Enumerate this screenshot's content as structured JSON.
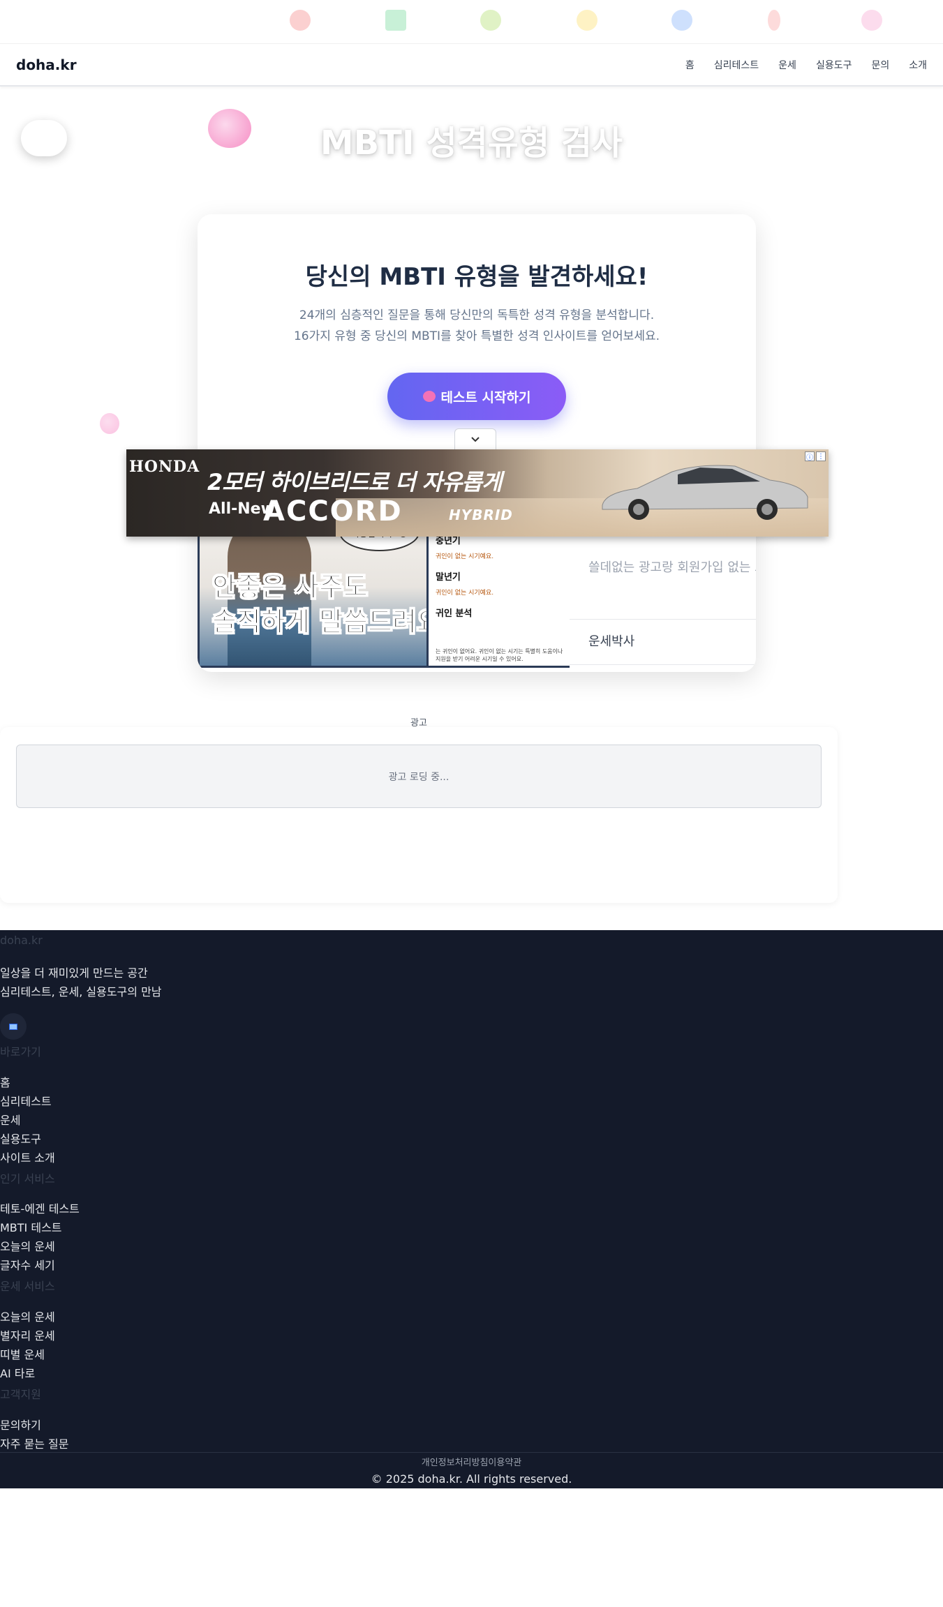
{
  "top_icons": [
    "target-icon",
    "chart-icon",
    "puzzle-icon",
    "bulb-icon",
    "magnifier-icon",
    "bolt-icon",
    "brain-icon"
  ],
  "top_icon_colors": [
    "#ef4444",
    "#22c55e",
    "#84cc16",
    "#facc15",
    "#3b82f6",
    "#f87171",
    "#f472b6"
  ],
  "header": {
    "logo": "doha.kr",
    "nav": [
      "홈",
      "심리테스트",
      "운세",
      "실용도구",
      "문의",
      "소개"
    ]
  },
  "hero": {
    "title": "MBTI 성격유형 검사"
  },
  "card": {
    "title": "당신의 MBTI 유형을 발견하세요!",
    "desc_line1": "24개의 심층적인 질문을 통해 당신만의 독특한 성격 유형을 분석합니다.",
    "desc_line2": "16가지 유형 중 당신의 MBTI를 찾아 특별한 성격 인사이트를 얻어보세요.",
    "start_button": "테스트 시작하기"
  },
  "promo": {
    "bubble": "죄송합니다..😅",
    "headline_line1": "안좋은 사주도",
    "headline_line2": "솔직하게 말씀드려요..",
    "right_label_1": "중년기",
    "right_label_2": "말년기",
    "right_label_3": "귀인 분석",
    "right_sub": "귀인이 없는 시기예요.",
    "right_small": "는 귀인이 없어요. 귀인이 없는 시기는 특별히 도움이나 지원을 받기 어려운 시기일 수 있어요.",
    "text": "쓸데없는 광고랑 회원가입 없는 고",
    "source": "운세박사"
  },
  "ad_banner": {
    "brand": "HONDA",
    "headline": "2모터 하이브리드로 더 자유롭게",
    "all_new": "All-New",
    "model": "ACCORD",
    "model_suffix": "HYBRID",
    "info_icon": "ⓘ",
    "close_icon": "⋮"
  },
  "ad_section": {
    "label": "광고",
    "loading": "광고 로딩 중..."
  },
  "footer": {
    "heading_site": "doha.kr",
    "tagline1": "일상을 더 재미있게 만드는 공간",
    "tagline2": "심리테스트, 운세, 실용도구의 만남",
    "heading_menu": "바로가기",
    "menu": [
      "홈",
      "심리테스트",
      "운세",
      "실용도구",
      "사이트 소개"
    ],
    "heading_popular": "인기 서비스",
    "popular": [
      "테토-에겐 테스트",
      "MBTI 테스트",
      "오늘의 운세",
      "글자수 세기"
    ],
    "heading_fortune": "운세 서비스",
    "fortune": [
      "오늘의 운세",
      "별자리 운세",
      "띠별 운세",
      "AI 타로"
    ],
    "heading_support": "고객지원",
    "support": [
      "문의하기",
      "자주 묻는 질문"
    ],
    "legal_privacy": "개인정보처리방침",
    "legal_terms": "이용약관",
    "copyright": "© 2025 doha.kr. All rights reserved."
  }
}
